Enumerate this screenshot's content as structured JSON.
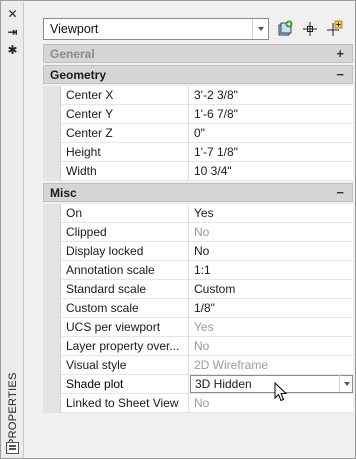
{
  "palette": {
    "title": "PROPERTIES",
    "close_glyph": "✕",
    "autohide_glyph": "⇥",
    "settings_glyph": "✱",
    "bottom_icon": "properties-list-icon"
  },
  "selector": {
    "value": "Viewport",
    "tools": [
      "quick-select-icon",
      "select-objects-icon",
      "toggle-pickadd-icon"
    ]
  },
  "categories": {
    "general": {
      "label": "General",
      "toggle": "+"
    },
    "geometry": {
      "label": "Geometry",
      "toggle": "−"
    },
    "misc": {
      "label": "Misc",
      "toggle": "−"
    }
  },
  "geometry": [
    {
      "name": "Center X",
      "value": "3'-2 3/8\""
    },
    {
      "name": "Center Y",
      "value": "1'-6 7/8\""
    },
    {
      "name": "Center Z",
      "value": "0\""
    },
    {
      "name": "Height",
      "value": "1'-7 1/8\""
    },
    {
      "name": "Width",
      "value": "10 3/4\""
    }
  ],
  "misc": [
    {
      "name": "On",
      "value": "Yes"
    },
    {
      "name": "Clipped",
      "value": "No"
    },
    {
      "name": "Display locked",
      "value": "No"
    },
    {
      "name": "Annotation scale",
      "value": "1:1"
    },
    {
      "name": "Standard scale",
      "value": "Custom"
    },
    {
      "name": "Custom scale",
      "value": "1/8\""
    },
    {
      "name": "UCS per viewport",
      "value": "Yes"
    },
    {
      "name": "Layer property over...",
      "value": "No"
    },
    {
      "name": "Visual style",
      "value": "2D Wireframe"
    },
    {
      "name": "Shade plot",
      "value": "3D Hidden"
    },
    {
      "name": "Linked to Sheet View",
      "value": "No"
    }
  ],
  "colors": {
    "accent_green": "#3a9a3a",
    "dim_text": "#9a9a9a"
  }
}
